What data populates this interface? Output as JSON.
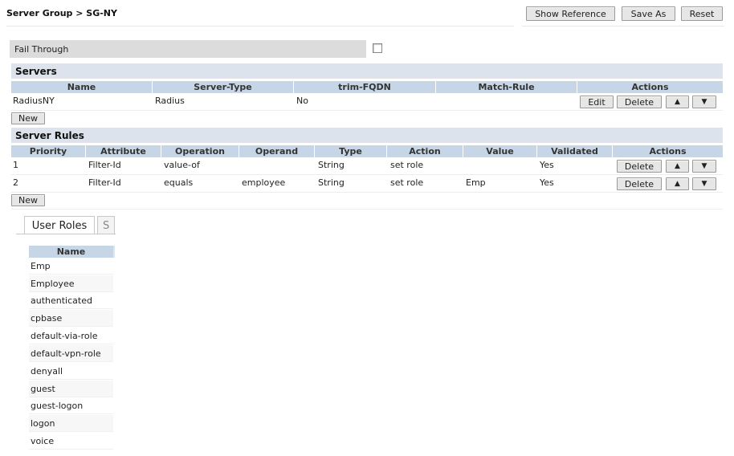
{
  "header": {
    "breadcrumb": "Server Group > SG-NY",
    "show_reference": "Show Reference",
    "save_as": "Save As",
    "reset": "Reset"
  },
  "fail_through": {
    "label": "Fail Through",
    "checked": false
  },
  "servers": {
    "title": "Servers",
    "columns": [
      "Name",
      "Server-Type",
      "trim-FQDN",
      "Match-Rule",
      "Actions"
    ],
    "rows": [
      {
        "name": "RadiusNY",
        "server_type": "Radius",
        "trim_fqdn": "No",
        "match_rule": ""
      }
    ],
    "edit_label": "Edit",
    "delete_label": "Delete",
    "up_glyph": "▲",
    "down_glyph": "▼",
    "new_label": "New"
  },
  "server_rules": {
    "title": "Server Rules",
    "columns": [
      "Priority",
      "Attribute",
      "Operation",
      "Operand",
      "Type",
      "Action",
      "Value",
      "Validated",
      "Actions"
    ],
    "rows": [
      {
        "priority": "1",
        "attribute": "Filter-Id",
        "operation": "value-of",
        "operand": "",
        "type": "String",
        "action": "set role",
        "value": "",
        "validated": "Yes"
      },
      {
        "priority": "2",
        "attribute": "Filter-Id",
        "operation": "equals",
        "operand": "employee",
        "type": "String",
        "action": "set role",
        "value": "Emp",
        "validated": "Yes"
      }
    ],
    "delete_label": "Delete",
    "up_glyph": "▲",
    "down_glyph": "▼",
    "new_label": "New"
  },
  "tabs": {
    "user_roles": "User Roles",
    "second": "S"
  },
  "user_roles": {
    "column": "Name",
    "items": [
      "Emp",
      "Employee",
      "authenticated",
      "cpbase",
      "default-via-role",
      "default-vpn-role",
      "denyall",
      "guest",
      "guest-logon",
      "logon",
      "voice"
    ]
  }
}
